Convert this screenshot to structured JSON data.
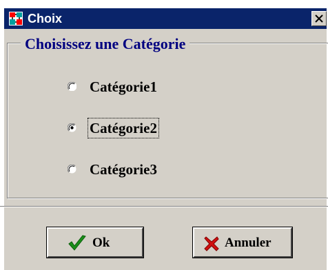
{
  "window": {
    "title": "Choix",
    "titlebar_color": "#0a246a",
    "face_color": "#d4d0c8"
  },
  "group": {
    "legend": "Choisissez une Catégorie",
    "legend_color": "#000080"
  },
  "options": [
    {
      "label": "Catégorie1",
      "checked": false
    },
    {
      "label": "Catégorie2",
      "checked": true
    },
    {
      "label": "Catégorie3",
      "checked": false
    }
  ],
  "buttons": {
    "ok_label": "Ok",
    "cancel_label": "Annuler"
  },
  "icons": {
    "app": "app-window-icon",
    "close": "close-icon",
    "ok": "green-checkmark-icon",
    "cancel": "red-x-icon"
  }
}
